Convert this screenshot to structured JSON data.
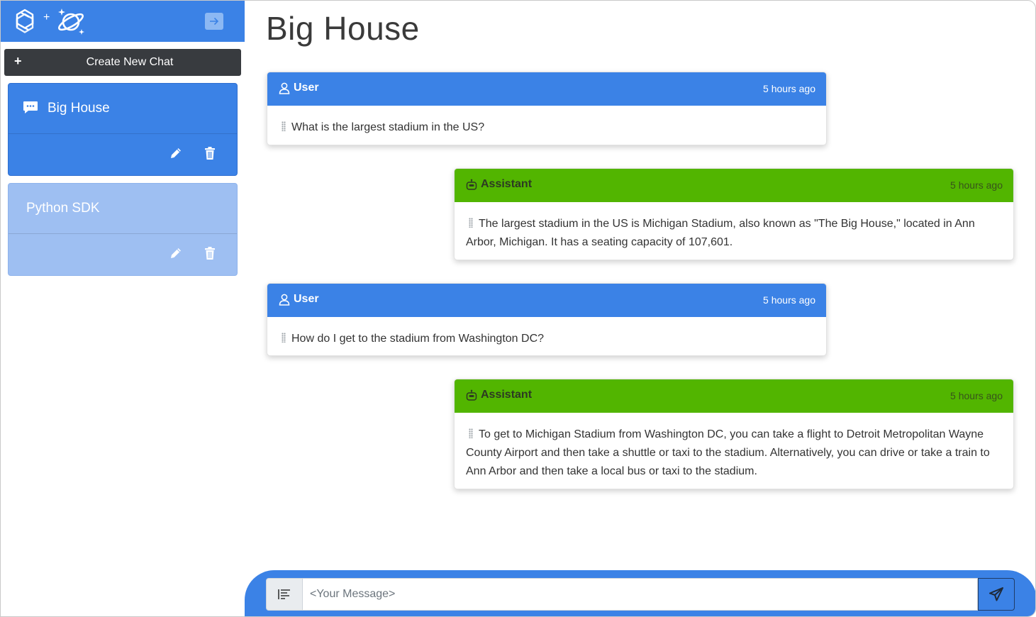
{
  "sidebar": {
    "logo_plus": "+",
    "new_chat_label": "Create New Chat",
    "new_chat_icon": "plus-icon",
    "chats": [
      {
        "title": "Big House",
        "active": true
      },
      {
        "title": "Python SDK",
        "active": false
      }
    ]
  },
  "main": {
    "title": "Big House",
    "messages": [
      {
        "role": "User",
        "time": "5 hours ago",
        "text": "What is the largest stadium in the US?"
      },
      {
        "role": "Assistant",
        "time": "5 hours ago",
        "text": "The largest stadium in the US is Michigan Stadium, also known as \"The Big House,\" located in Ann Arbor, Michigan. It has a seating capacity of 107,601."
      },
      {
        "role": "User",
        "time": "5 hours ago",
        "text": "How do I get to the stadium from Washington DC?"
      },
      {
        "role": "Assistant",
        "time": "5 hours ago",
        "text": "To get to Michigan Stadium from Washington DC, you can take a flight to Detroit Metropolitan Wayne County Airport and then take a shuttle or taxi to the stadium. Alternatively, you can drive or take a train to Ann Arbor and then take a local bus or taxi to the stadium."
      }
    ]
  },
  "composer": {
    "placeholder": "<Your Message>"
  },
  "colors": {
    "primary": "#3b82e6",
    "assistant": "#52b500",
    "dark_button": "#383b3f",
    "inactive_chat": "#9ebff2"
  }
}
